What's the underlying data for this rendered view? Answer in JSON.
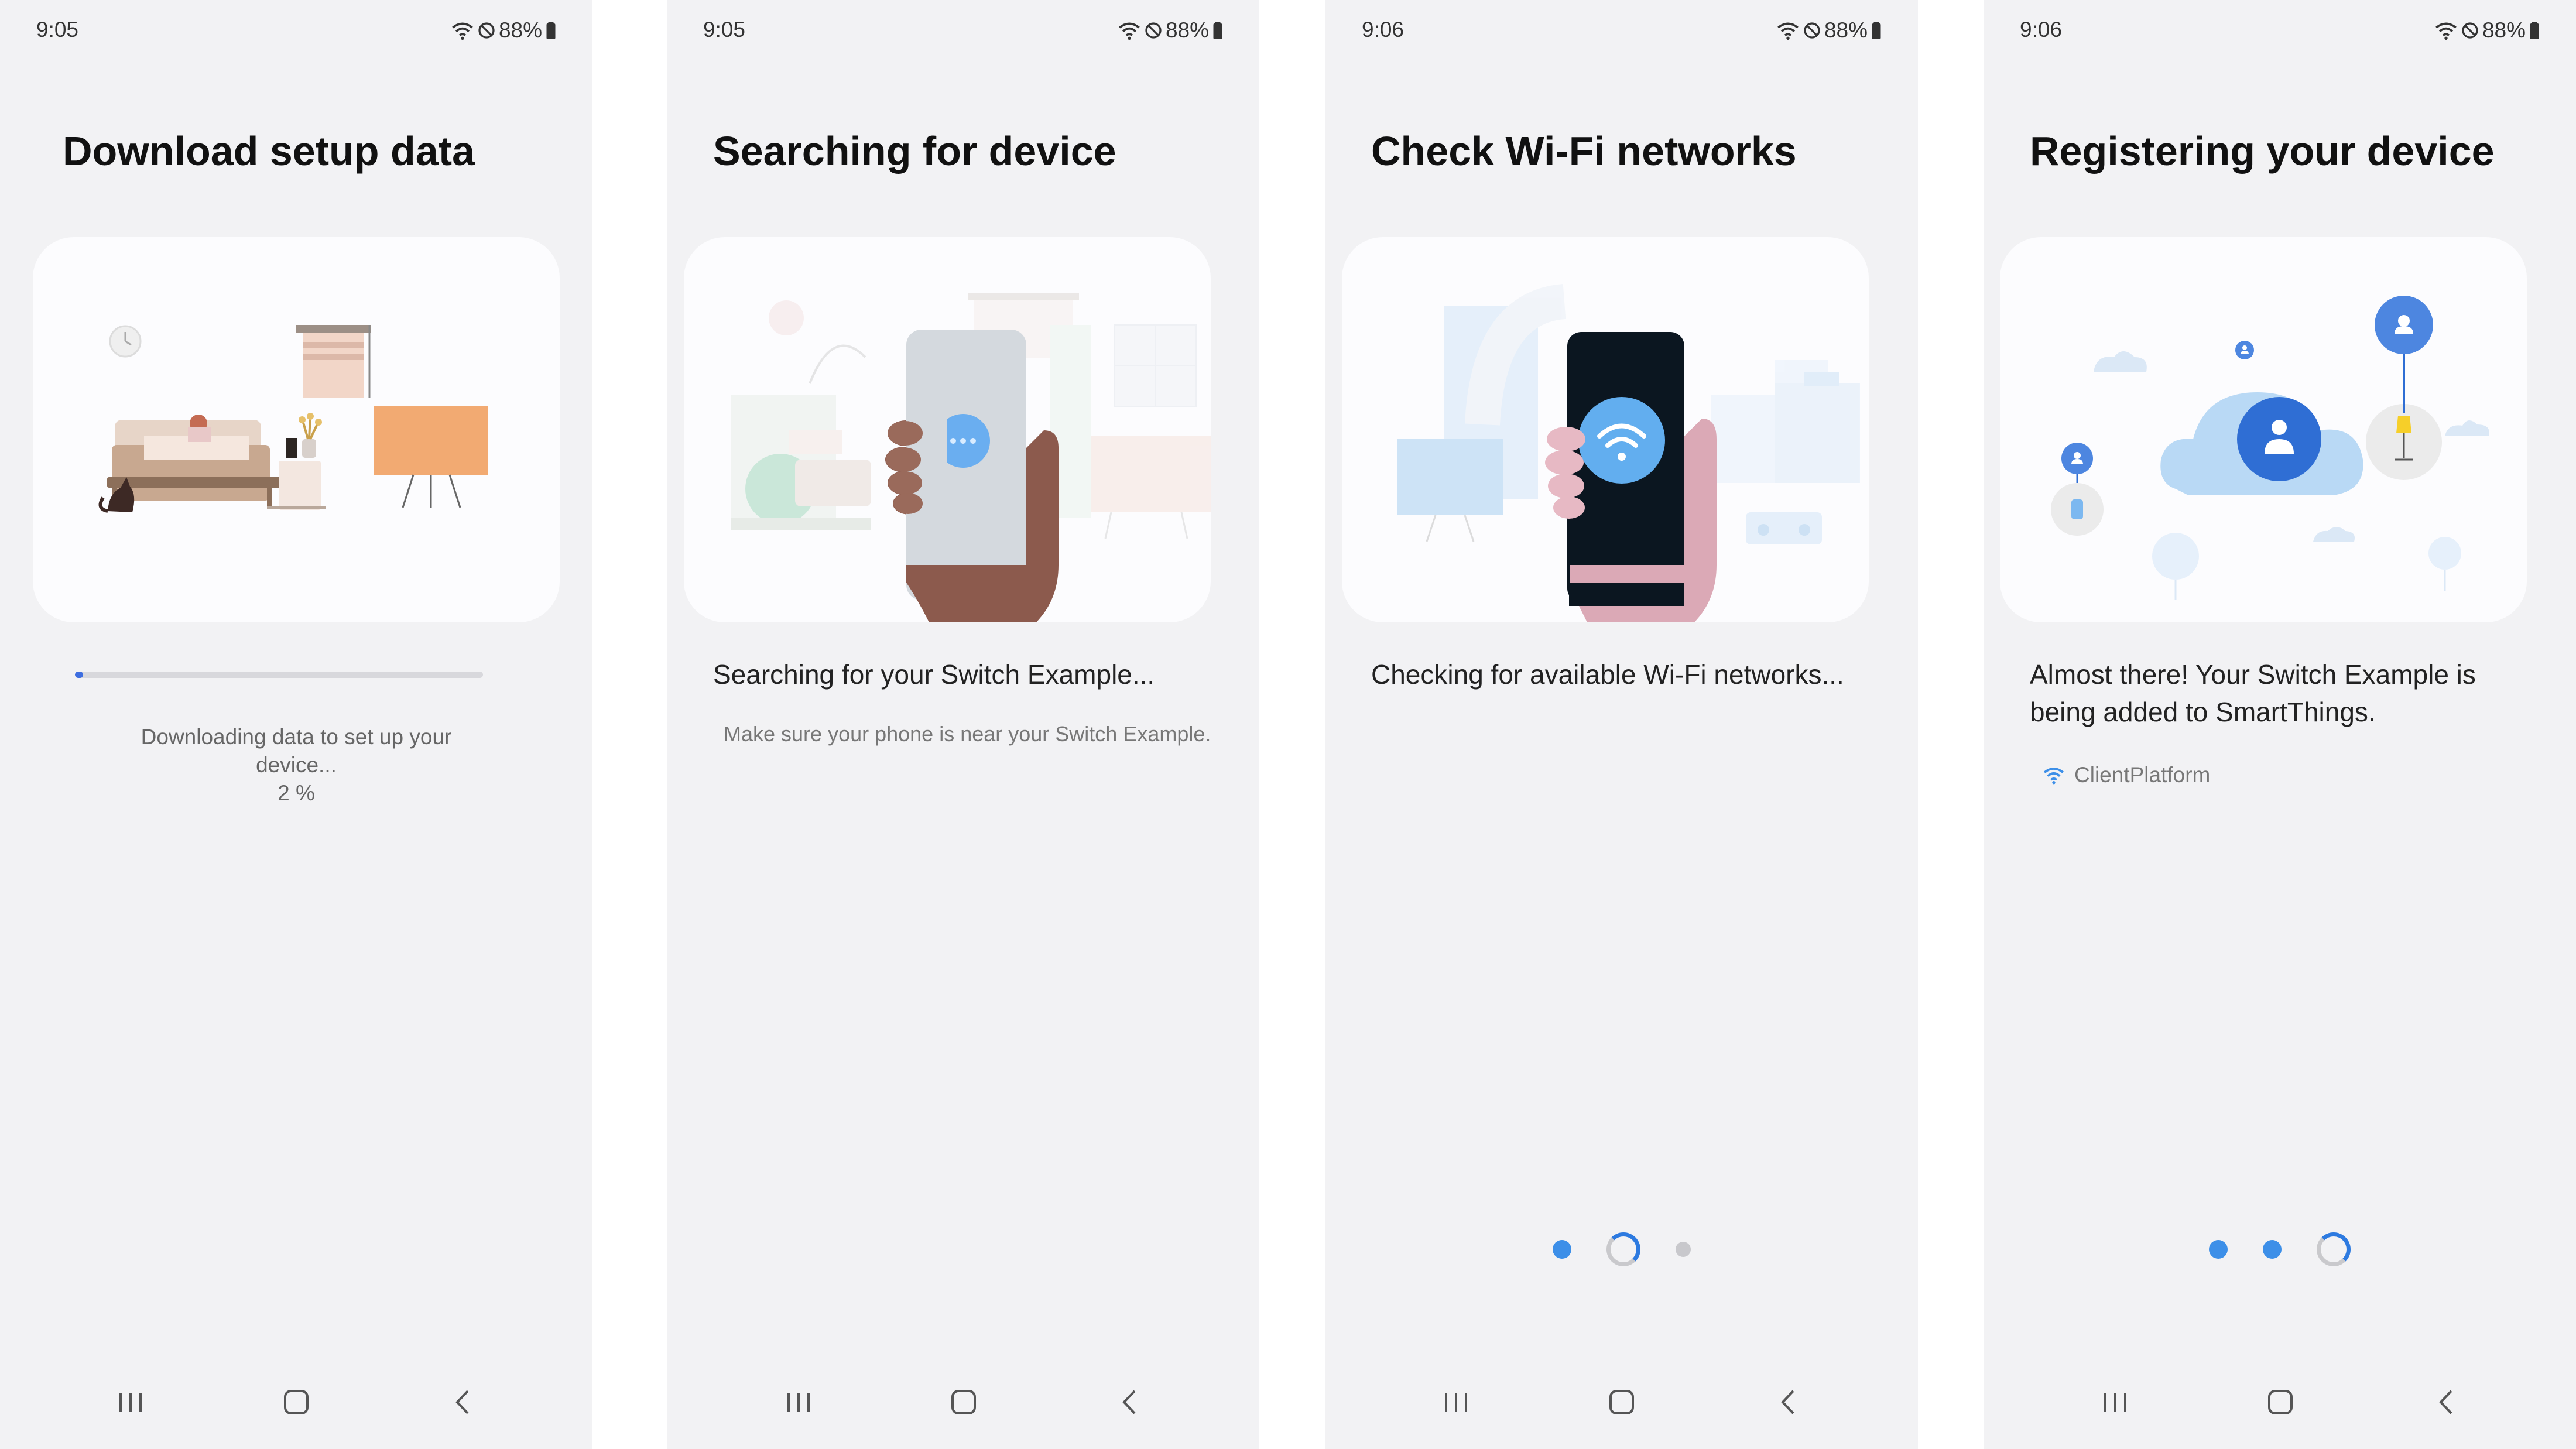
{
  "screens": [
    {
      "time": "9:05",
      "battery": "88%",
      "title": "Download setup data",
      "illustration": "bedroom-setup-illustration",
      "progress": 0.02,
      "status_line1": "Downloading data to set up your",
      "status_line2": "device...",
      "progress_label": "2 %"
    },
    {
      "time": "9:05",
      "battery": "88%",
      "title": "Searching for device",
      "illustration": "phone-search-illustration",
      "message": "Searching for your Switch Example...",
      "hint": "Make sure your phone is near your Switch Example."
    },
    {
      "time": "9:06",
      "battery": "88%",
      "title": "Check Wi-Fi networks",
      "illustration": "phone-wifi-illustration",
      "message": "Checking for available Wi-Fi networks...",
      "steps": [
        "complete",
        "in-progress",
        "pending"
      ]
    },
    {
      "time": "9:06",
      "battery": "88%",
      "title": "Registering your device",
      "illustration": "cloud-register-illustration",
      "message": "Almost there! Your Switch Example is being added to SmartThings.",
      "source": "ClientPlatform",
      "steps": [
        "complete",
        "complete",
        "in-progress"
      ]
    }
  ],
  "icons": {
    "status": [
      "wifi-icon",
      "do-not-disturb-icon",
      "battery-icon"
    ],
    "nav": [
      "recent-apps-icon",
      "home-icon",
      "back-icon"
    ],
    "source": "wifi-small-icon"
  },
  "colors": {
    "accent": "#3d8fe8",
    "progress": "#3e6ee0",
    "background": "#f2f2f4",
    "card": "#fcfcfe"
  }
}
